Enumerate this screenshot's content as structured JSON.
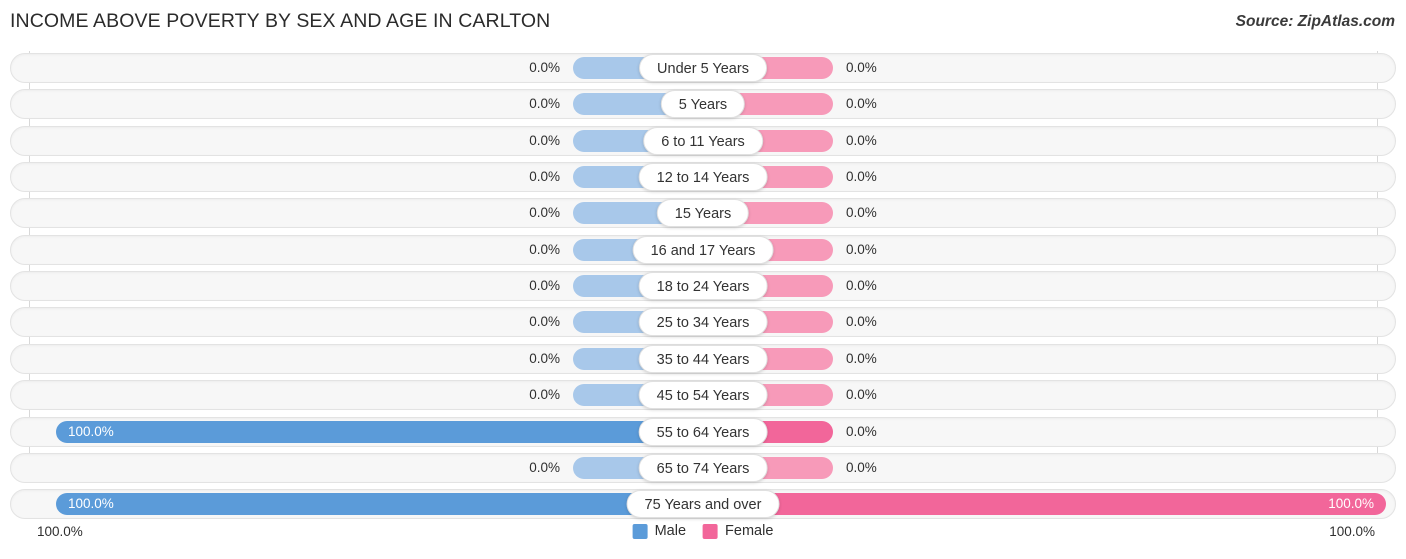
{
  "header": {
    "title": "INCOME ABOVE POVERTY BY SEX AND AGE IN CARLTON",
    "source": "Source: ZipAtlas.com"
  },
  "legend": {
    "male_label": "Male",
    "female_label": "Female",
    "male_color": "#5b9bd9",
    "female_color": "#f2669a"
  },
  "axis": {
    "left_end_label": "100.0%",
    "right_end_label": "100.0%"
  },
  "chart_data": {
    "type": "bar",
    "title": "INCOME ABOVE POVERTY BY SEX AND AGE IN CARLTON",
    "subtitle": "",
    "xlabel": "",
    "ylabel": "",
    "orientation": "horizontal",
    "style": "bidirectional-bar",
    "grid": false,
    "legend_position": "bottom-center",
    "xlim": [
      0,
      100
    ],
    "axis_end_labels": [
      "100.0%",
      "100.0%"
    ],
    "categories": [
      "Under 5 Years",
      "5 Years",
      "6 to 11 Years",
      "12 to 14 Years",
      "15 Years",
      "16 and 17 Years",
      "18 to 24 Years",
      "25 to 34 Years",
      "35 to 44 Years",
      "45 to 54 Years",
      "55 to 64 Years",
      "65 to 74 Years",
      "75 Years and over"
    ],
    "series": [
      {
        "name": "Male",
        "color": "#5b9bd9",
        "values": [
          0.0,
          0.0,
          0.0,
          0.0,
          0.0,
          0.0,
          0.0,
          0.0,
          0.0,
          0.0,
          100.0,
          0.0,
          100.0
        ],
        "labels": [
          "0.0%",
          "0.0%",
          "0.0%",
          "0.0%",
          "0.0%",
          "0.0%",
          "0.0%",
          "0.0%",
          "0.0%",
          "0.0%",
          "100.0%",
          "0.0%",
          "100.0%"
        ]
      },
      {
        "name": "Female",
        "color": "#f2669a",
        "values": [
          0.0,
          0.0,
          0.0,
          0.0,
          0.0,
          0.0,
          0.0,
          0.0,
          0.0,
          0.0,
          0.0,
          0.0,
          100.0
        ],
        "labels": [
          "0.0%",
          "0.0%",
          "0.0%",
          "0.0%",
          "0.0%",
          "0.0%",
          "0.0%",
          "0.0%",
          "0.0%",
          "0.0%",
          "0.0%",
          "0.0%",
          "100.0%"
        ]
      }
    ]
  }
}
